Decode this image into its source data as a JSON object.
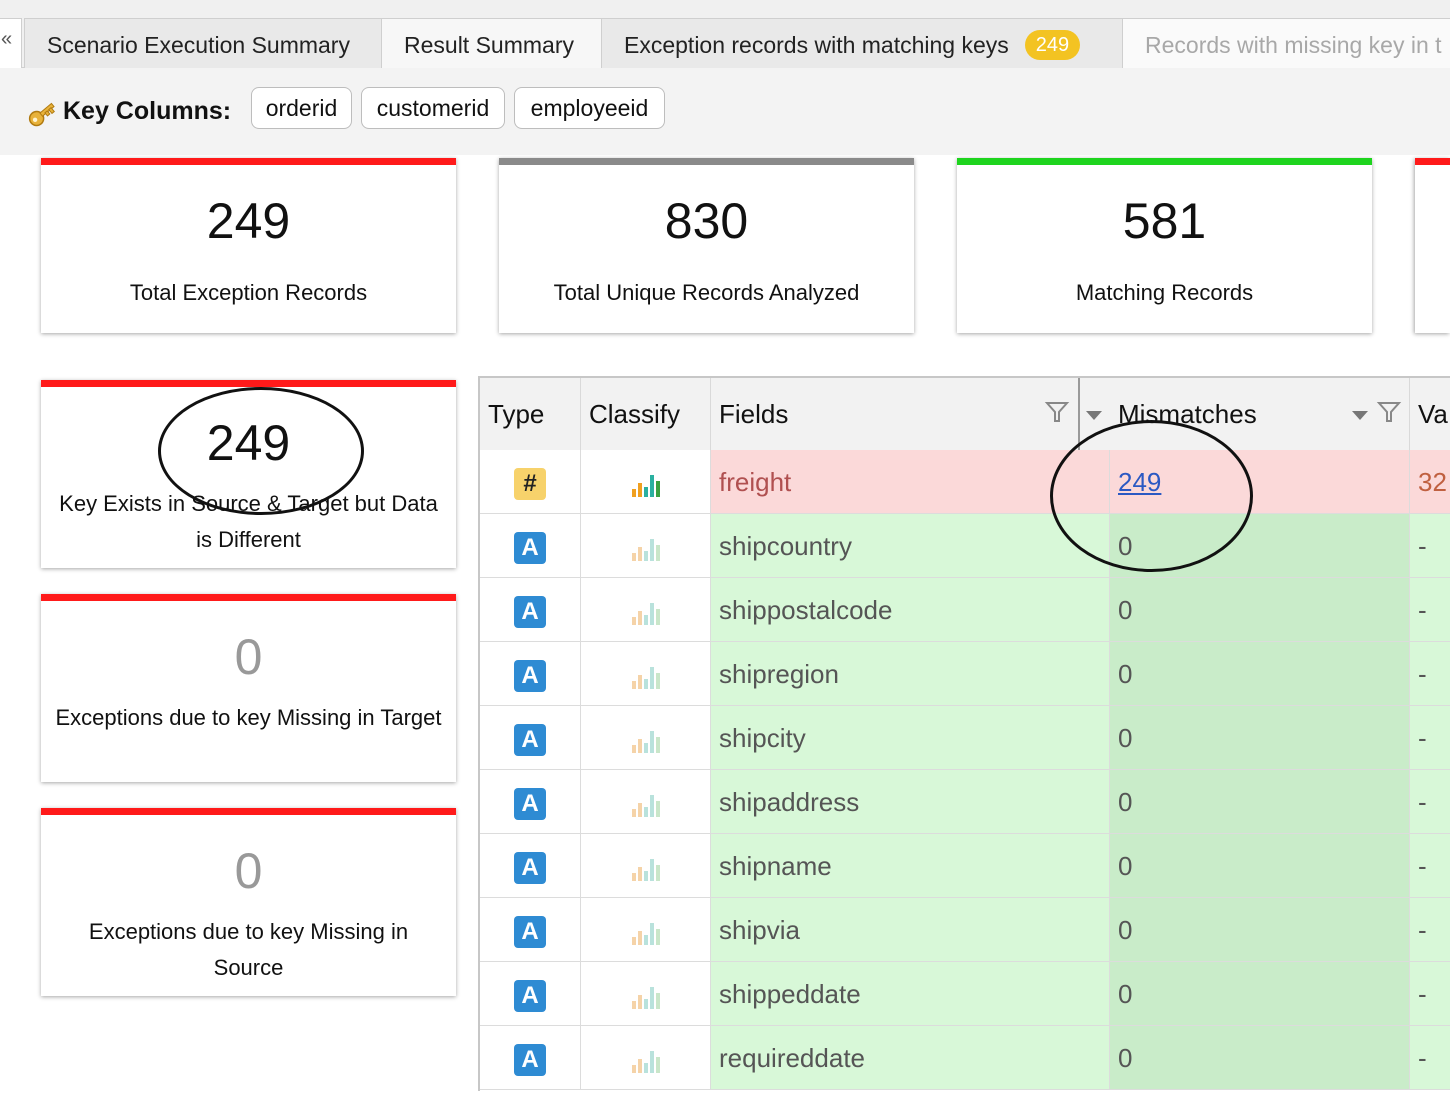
{
  "collapse_glyph": "«",
  "tabs": [
    {
      "label": "Scenario Execution Summary"
    },
    {
      "label": "Result Summary"
    },
    {
      "label": "Exception records with matching keys",
      "badge": "249"
    },
    {
      "label": "Records with missing key in t"
    }
  ],
  "key_columns": {
    "label": "Key Columns:",
    "chips": [
      "orderid",
      "customerid",
      "employeeid"
    ]
  },
  "cards": [
    {
      "value": "249",
      "label": "Total Exception Records",
      "accent": "#ff1a1a"
    },
    {
      "value": "830",
      "label": "Total Unique Records Analyzed",
      "accent": "#8a8a8a"
    },
    {
      "value": "581",
      "label": "Matching Records",
      "accent": "#1ed41e"
    }
  ],
  "side_cards": [
    {
      "value": "249",
      "label": "Key Exists in Source & Target but Data is Different",
      "accent": "#ff1a1a"
    },
    {
      "value": "0",
      "label": "Exceptions due to key Missing in Target",
      "accent": "#ff1a1a"
    },
    {
      "value": "0",
      "label": "Exceptions due to key Missing in Source",
      "accent": "#ff1a1a"
    }
  ],
  "table": {
    "headers": {
      "type": "Type",
      "classify": "Classify",
      "fields": "Fields",
      "mismatches": "Mismatches",
      "values": "Va"
    },
    "rows": [
      {
        "type": "#",
        "field": "freight",
        "mismatches": "249",
        "value": "32"
      },
      {
        "type": "A",
        "field": "shipcountry",
        "mismatches": "0",
        "value": "-"
      },
      {
        "type": "A",
        "field": "shippostalcode",
        "mismatches": "0",
        "value": "-"
      },
      {
        "type": "A",
        "field": "shipregion",
        "mismatches": "0",
        "value": "-"
      },
      {
        "type": "A",
        "field": "shipcity",
        "mismatches": "0",
        "value": "-"
      },
      {
        "type": "A",
        "field": "shipaddress",
        "mismatches": "0",
        "value": "-"
      },
      {
        "type": "A",
        "field": "shipname",
        "mismatches": "0",
        "value": "-"
      },
      {
        "type": "A",
        "field": "shipvia",
        "mismatches": "0",
        "value": "-"
      },
      {
        "type": "A",
        "field": "shippeddate",
        "mismatches": "0",
        "value": "-"
      },
      {
        "type": "A",
        "field": "requireddate",
        "mismatches": "0",
        "value": "-"
      }
    ]
  },
  "colors": {
    "red_accent": "#ff1a1a",
    "green_accent": "#1ed41e",
    "link": "#2b59c3"
  }
}
